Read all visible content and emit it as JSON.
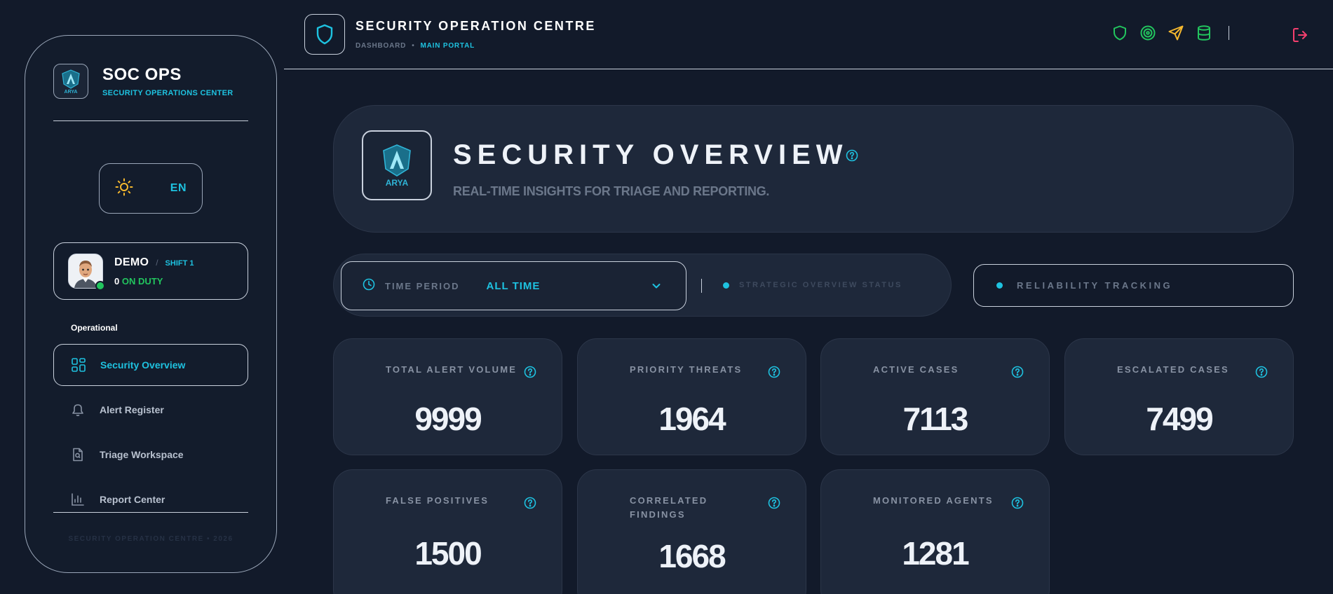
{
  "sidebar": {
    "brand_title": "SOC OPS",
    "brand_subtitle": "SECURITY OPERATIONS CENTER",
    "logo_text": "ARYA",
    "language": "EN",
    "user": {
      "name": "DEMO",
      "separator": "/",
      "shift": "SHIFT 1",
      "count": "0",
      "status": "ON DUTY"
    },
    "section_label": "Operational",
    "nav": [
      {
        "label": "Security Overview",
        "icon": "grid-icon"
      },
      {
        "label": "Alert Register",
        "icon": "bell-icon"
      },
      {
        "label": "Triage Workspace",
        "icon": "file-search-icon"
      },
      {
        "label": "Report Center",
        "icon": "bar-chart-icon"
      }
    ],
    "footer": "SECURITY OPERATION CENTRE • 2026"
  },
  "header": {
    "title": "SECURITY OPERATION CENTRE",
    "breadcrumb_1": "DASHBOARD",
    "breadcrumb_sep": "•",
    "breadcrumb_2": "MAIN PORTAL",
    "icons": [
      "shield-icon",
      "target-icon",
      "send-icon",
      "database-icon",
      "logout-icon"
    ]
  },
  "hero": {
    "logo_text": "ARYA",
    "title": "SECURITY OVERVIEW",
    "subtitle": "REAL-TIME INSIGHTS FOR TRIAGE AND REPORTING."
  },
  "filters": {
    "time_label": "TIME PERIOD",
    "time_value": "ALL TIME",
    "strategic_label": "STRATEGIC OVERVIEW STATUS",
    "reliability_label": "RELIABILITY TRACKING"
  },
  "metrics": [
    {
      "label": "TOTAL ALERT VOLUME",
      "value": "9999"
    },
    {
      "label": "PRIORITY THREATS",
      "value": "1964"
    },
    {
      "label": "ACTIVE CASES",
      "value": "7113"
    },
    {
      "label": "ESCALATED CASES",
      "value": "7499"
    },
    {
      "label": "FALSE POSITIVES",
      "value": "1500"
    },
    {
      "label": "CORRELATED FINDINGS",
      "value": "1668"
    },
    {
      "label": "MONITORED AGENTS",
      "value": "1281"
    }
  ],
  "colors": {
    "accent": "#1ec2e0",
    "success": "#22c55e",
    "warning": "#f5b82e",
    "danger": "#f43f6e",
    "background": "#121a2a",
    "card": "#1e283a"
  }
}
